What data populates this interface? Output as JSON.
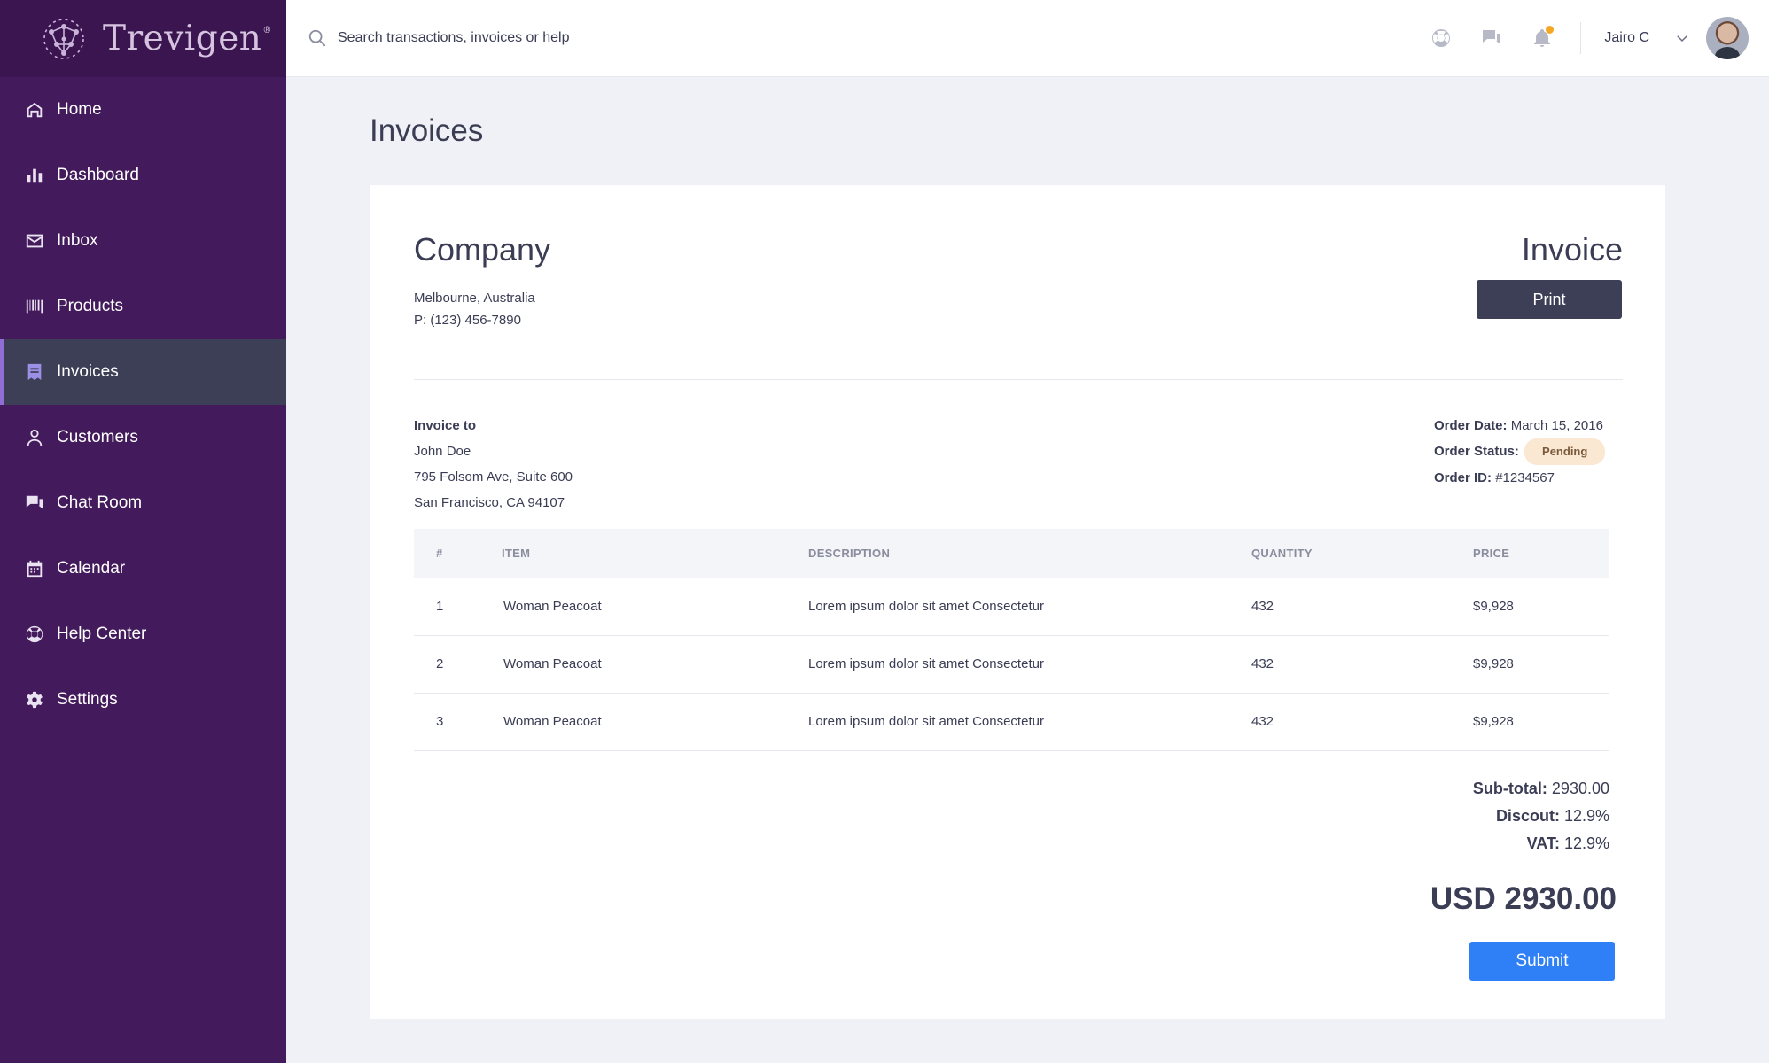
{
  "brand": {
    "name": "Trevigen",
    "mark": "®"
  },
  "sidebar": {
    "items": [
      {
        "label": "Home",
        "icon": "home-icon"
      },
      {
        "label": "Dashboard",
        "icon": "bar-chart-icon"
      },
      {
        "label": "Inbox",
        "icon": "mail-icon"
      },
      {
        "label": "Products",
        "icon": "barcode-icon"
      },
      {
        "label": "Invoices",
        "icon": "invoice-icon",
        "active": true
      },
      {
        "label": "Customers",
        "icon": "user-icon"
      },
      {
        "label": "Chat Room",
        "icon": "chat-icon"
      },
      {
        "label": "Calendar",
        "icon": "calendar-icon"
      },
      {
        "label": "Help Center",
        "icon": "lifebuoy-icon"
      },
      {
        "label": "Settings",
        "icon": "gear-icon"
      }
    ]
  },
  "topbar": {
    "search_placeholder": "Search transactions, invoices or help",
    "user_name": "Jairo C",
    "icons": [
      "lifebuoy-icon",
      "chat-icon",
      "bell-icon"
    ]
  },
  "page": {
    "title": "Invoices"
  },
  "invoice": {
    "company_name": "Company",
    "company_address": "Melbourne, Australia",
    "company_phone": "P: (123) 456-7890",
    "heading": "Invoice",
    "print_label": "Print",
    "bill_to_label": "Invoice to",
    "bill_to_name": "John Doe",
    "bill_to_street": "795 Folsom Ave, Suite 600",
    "bill_to_city": "San Francisco, CA 94107",
    "order_date_label": "Order Date:",
    "order_date": "March 15, 2016",
    "order_status_label": "Order Status:",
    "order_status": "Pending",
    "order_id_label": "Order ID:",
    "order_id": "#1234567",
    "table_headers": [
      "#",
      "ITEM",
      "DESCRIPTION",
      "QUANTITY",
      "PRICE"
    ],
    "rows": [
      {
        "num": "1",
        "item": "Woman Peacoat",
        "description": "Lorem ipsum dolor sit amet Consectetur",
        "quantity": "432",
        "price": "$9,928"
      },
      {
        "num": "2",
        "item": "Woman Peacoat",
        "description": "Lorem ipsum dolor sit amet Consectetur",
        "quantity": "432",
        "price": "$9,928"
      },
      {
        "num": "3",
        "item": "Woman Peacoat",
        "description": "Lorem ipsum dolor sit amet Consectetur",
        "quantity": "432",
        "price": "$9,928"
      }
    ],
    "subtotal_label": "Sub-total:",
    "subtotal": "2930.00",
    "discount_label": "Discout:",
    "discount": "12.9%",
    "vat_label": "VAT:",
    "vat": "12.9%",
    "grand_total": "USD 2930.00",
    "submit_label": "Submit"
  },
  "colors": {
    "sidebar_bg": "#431a5b",
    "active_item_bg": "#3c3f55",
    "primary_button": "#2f7ff7",
    "dark_button": "#3c3f55",
    "pending_badge": "#fbe8d3"
  }
}
